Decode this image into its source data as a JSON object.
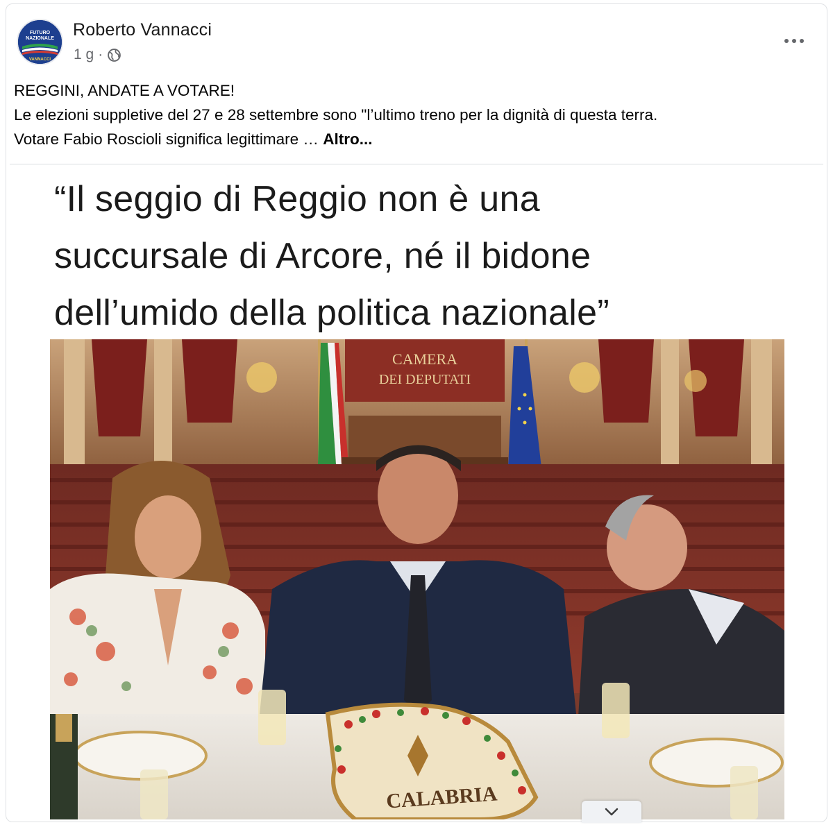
{
  "post": {
    "author": "Roberto Vannacci",
    "time": "1 g",
    "separator": "·",
    "privacy_icon": "globe-icon",
    "menu_icon": "more-horizontal-icon",
    "avatar": {
      "line1": "FUTURO",
      "line2": "NAZIONALE",
      "line3": "VANNACCI",
      "color": "#1d3f8f"
    },
    "text_lines": [
      "REGGINI, ANDATE A VOTARE!",
      "Le elezioni suppletive del 27 e 28 settembre sono \"l’ultimo treno per la dignità di questa terra.",
      "Votare Fabio Roscioli significa legittimare … "
    ],
    "more_label": "Altro..."
  },
  "media": {
    "headline_lines": [
      "“Il seggio di Reggio non è una",
      "succursale di Arcore, né il bidone",
      "dell’umido della politica nazionale”"
    ],
    "sign_line1": "CAMERA",
    "sign_line2": "DEI  DEPUTATI",
    "cake_text": "CALABRIA",
    "expand_icon": "chevron-down-icon"
  },
  "colors": {
    "text": "#050505",
    "secondary": "#65676b",
    "divider": "#dadde1",
    "chamber_red": "#7a2a22"
  }
}
